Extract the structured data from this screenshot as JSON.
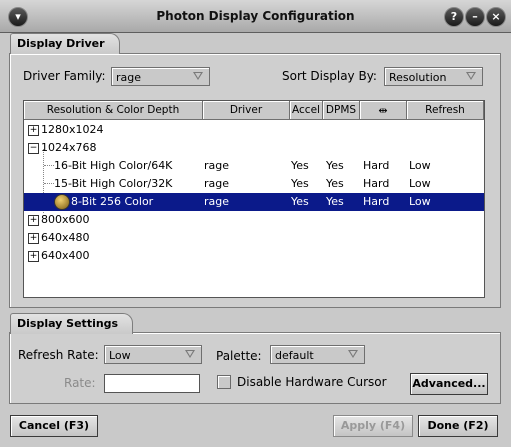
{
  "window": {
    "title": "Photon Display Configuration"
  },
  "titlebar_buttons": [
    "?",
    "–",
    "×"
  ],
  "driver_tab": {
    "label": "Display Driver"
  },
  "driver_family": {
    "label": "Driver Family:",
    "value": "rage"
  },
  "sort_by": {
    "label": "Sort Display By:",
    "value": "Resolution"
  },
  "columns": [
    "Resolution & Color Depth",
    "Driver",
    "Accel",
    "DPMS",
    "",
    "Refresh"
  ],
  "tree": [
    {
      "label": "1280x1024",
      "expander": "+"
    },
    {
      "label": "1024x768",
      "expander": "−"
    },
    {
      "label": "16-Bit High Color/64K",
      "driver": "rage",
      "accel": "Yes",
      "dpms": "Yes",
      "cursor": "Hard",
      "refresh": "Low"
    },
    {
      "label": "15-Bit High Color/32K",
      "driver": "rage",
      "accel": "Yes",
      "dpms": "Yes",
      "cursor": "Hard",
      "refresh": "Low"
    },
    {
      "label": "8-Bit 256 Color",
      "driver": "rage",
      "accel": "Yes",
      "dpms": "Yes",
      "cursor": "Hard",
      "refresh": "Low"
    },
    {
      "label": "800x600",
      "expander": "+"
    },
    {
      "label": "640x480",
      "expander": "+"
    },
    {
      "label": "640x400",
      "expander": "+"
    }
  ],
  "settings_tab": {
    "label": "Display Settings"
  },
  "refresh_rate": {
    "label": "Refresh Rate:",
    "value": "Low"
  },
  "palette": {
    "label": "Palette:",
    "value": "default"
  },
  "rate": {
    "label": "Rate:",
    "value": ""
  },
  "disable_cursor": {
    "label": "Disable Hardware Cursor"
  },
  "buttons": {
    "advanced": "Advanced...",
    "cancel": "Cancel (F3)",
    "apply": "Apply (F4)",
    "done": "Done (F2)"
  }
}
